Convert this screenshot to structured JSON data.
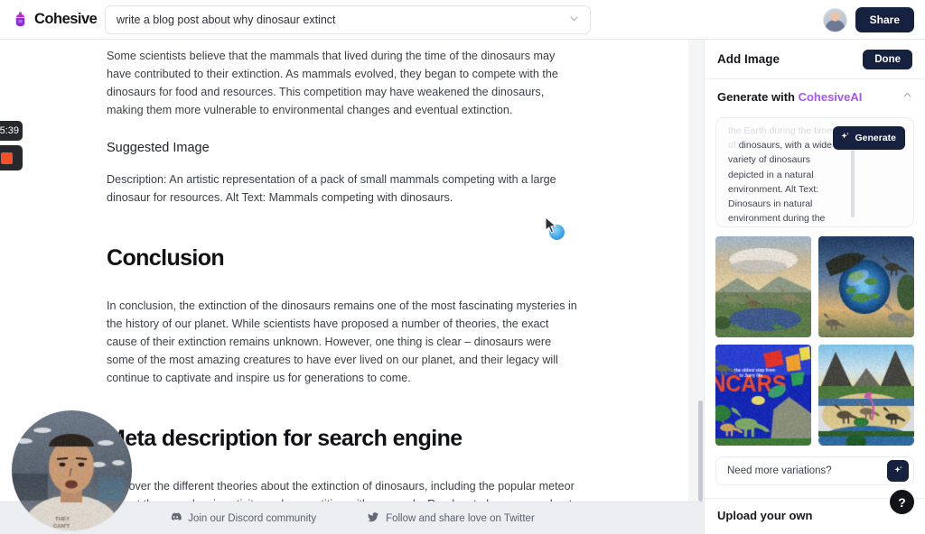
{
  "app": {
    "brand_name": "Cohesive",
    "brand_logo_icon": "cohesive-logo-icon"
  },
  "topbar": {
    "document_title": "write a blog post about why dinosaur extinct",
    "dropdown_icon": "chevron-down-icon",
    "avatar_icon": "user-avatar",
    "share_label": "Share"
  },
  "document": {
    "paragraph_1": "Some scientists believe that the mammals that lived during the time of the dinosaurs may have contributed to their extinction. As mammals evolved, they began to compete with the dinosaurs for food and resources. This competition may have weakened the dinosaurs, making them more vulnerable to environmental changes and eventual extinction.",
    "suggested_image_heading": "Suggested Image",
    "suggested_image_description": "Description: An artistic representation of a pack of small mammals competing with a large dinosaur for resources. Alt Text: Mammals competing with dinosaurs.",
    "conclusion_heading": "Conclusion",
    "conclusion_paragraph": "In conclusion, the extinction of the dinosaurs remains one of the most fascinating mysteries in the history of our planet. While scientists have proposed a number of theories, the exact cause of their extinction remains unknown. However, one thing is clear – dinosaurs were some of the most amazing creatures to have ever lived on our planet, and their legacy will continue to captivate and inspire us for generations to come.",
    "meta_description_heading": "Meta description for search engine",
    "meta_description_paragraph": "Discover the different theories about the extinction of dinosaurs, including the popular meteor impact theory, volcanic activity, and competition with mammals. Read on to learn more about these prehistoric creatures and share your fascination with others.",
    "highlight_color": "#ffe600"
  },
  "footer": {
    "discord_label": "Join our Discord community",
    "discord_icon": "discord-icon",
    "twitter_label": "Follow and share love on Twitter",
    "twitter_icon": "twitter-icon"
  },
  "panel": {
    "title": "Add Image",
    "done_label": "Done",
    "generate_section": {
      "label_prefix": "Generate with ",
      "label_accent": "CohesiveAI",
      "collapse_icon": "chevron-up-icon",
      "accent_color": "#a855f7",
      "prompt_text_clipped": "the Earth during the time of",
      "prompt_text": "dinosaurs, with a wide variety of dinosaurs depicted in a natural environment. Alt Text: Dinosaurs in natural environment during the Jurassic period.",
      "generate_label": "Generate",
      "generate_icon": "sparkle-icon"
    },
    "thumbnails": [
      {
        "name": "dinosaur-landscape-sunset",
        "alt": "Dinosaurs by a lake at sunset"
      },
      {
        "name": "dinosaur-earth-globe",
        "alt": "Dinosaurs around planet Earth"
      },
      {
        "name": "dinosaur-cars-poster",
        "alt": "Cartoon dinosaur poster"
      },
      {
        "name": "dinosaur-valley-volcano",
        "alt": "Dinosaurs in a volcanic valley"
      }
    ],
    "variations": {
      "label": "Need more variations?",
      "icon": "sparkle-icon"
    },
    "upload_label": "Upload your own"
  },
  "overlays": {
    "recording_time": "5:39",
    "stop_icon": "stop-recording-icon",
    "webcam_name": "webcam-self-view",
    "help_label": "?",
    "cursor_icon": "mouse-cursor-icon"
  }
}
